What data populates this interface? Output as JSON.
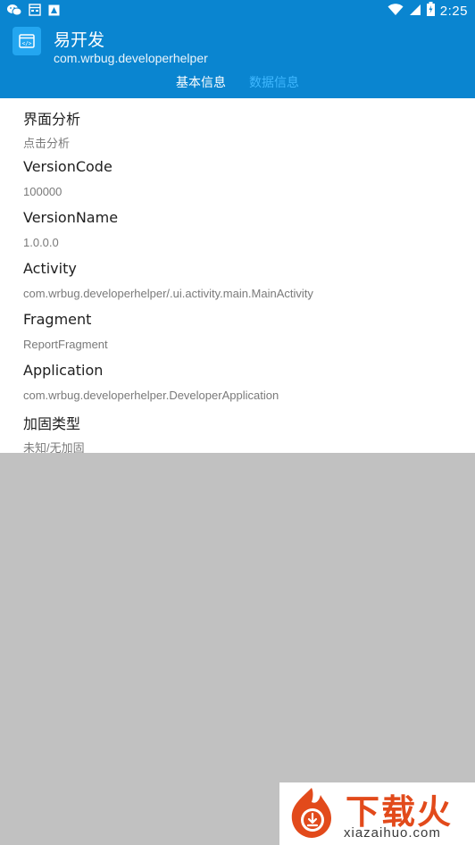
{
  "status_bar": {
    "time": "2:25",
    "left_icons": [
      "wechat-icon",
      "calendar-icon",
      "gallery-icon"
    ],
    "right_icons": [
      "wifi-icon",
      "signal-icon",
      "battery-icon"
    ]
  },
  "app_bar": {
    "title": "易开发",
    "package": "com.wrbug.developerhelper",
    "icon": "app-window-icon",
    "background": "#0a85d0"
  },
  "tabs": [
    {
      "label": "基本信息",
      "active": true
    },
    {
      "label": "数据信息",
      "active": false
    }
  ],
  "info": [
    {
      "label": "界面分析",
      "value": "点击分析"
    },
    {
      "label": "VersionCode",
      "value": "100000"
    },
    {
      "label": "VersionName",
      "value": "1.0.0.0"
    },
    {
      "label": "Activity",
      "value": "com.wrbug.developerhelper/.ui.activity.main.MainActivity"
    },
    {
      "label": "Fragment",
      "value": "ReportFragment"
    },
    {
      "label": "Application",
      "value": "com.wrbug.developerhelper.DeveloperApplication"
    },
    {
      "label": "加固类型",
      "value": "未知/无加固"
    }
  ],
  "watermark": {
    "title": "下载火",
    "domain": "xiazaihuo.com",
    "icon": "fire-download-icon",
    "accent": "#e24a1b"
  }
}
